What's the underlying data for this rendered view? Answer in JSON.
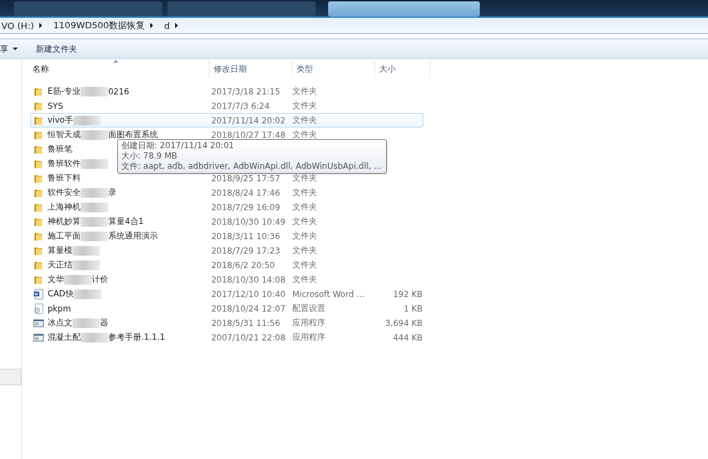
{
  "address_bar": {
    "crumbs": [
      "VO (H:)",
      "1109WD500数据恢复",
      "d"
    ]
  },
  "toolbar": {
    "buttons": [
      {
        "label": "享",
        "dropdown": true
      },
      {
        "label": "新建文件夹",
        "dropdown": false
      }
    ]
  },
  "table": {
    "columns": [
      {
        "label": "名称",
        "sorted": true
      },
      {
        "label": "修改日期",
        "sorted": false
      },
      {
        "label": "类型",
        "sorted": false
      },
      {
        "label": "大小",
        "sorted": false
      }
    ],
    "rows": [
      {
        "kind": "folder",
        "name": [
          "E筋-专业",
          "0216"
        ],
        "date": "2017/3/18 21:15",
        "type": "文件夹",
        "selected": false
      },
      {
        "kind": "folder",
        "name": [
          "SYS"
        ],
        "date": "2017/7/3 6:24",
        "type": "文件夹",
        "selected": false
      },
      {
        "kind": "folder",
        "name": [
          "vivo手"
        ],
        "redacted_tail": true,
        "date": "2017/11/14 20:02",
        "type": "文件夹",
        "selected": true
      },
      {
        "kind": "folder",
        "name": [
          "恒智天成",
          "面图布置系统"
        ],
        "date": "2018/10/27 17:48",
        "type": "文件夹",
        "selected": false
      },
      {
        "kind": "folder",
        "name": [
          "鲁班笔"
        ],
        "selected": false
      },
      {
        "kind": "folder",
        "name": [
          "鲁班软件"
        ],
        "redacted_tail": true,
        "selected": false
      },
      {
        "kind": "folder",
        "name": [
          "鲁班下料"
        ],
        "date": "2018/9/25 17:57",
        "type": "文件夹",
        "selected": false
      },
      {
        "kind": "folder",
        "name": [
          "软件安全",
          "录"
        ],
        "date": "2018/8/24 17:46",
        "type": "文件夹",
        "selected": false
      },
      {
        "kind": "folder",
        "name": [
          "上海神机"
        ],
        "redacted_tail": true,
        "date": "2018/7/29 16:09",
        "type": "文件夹",
        "selected": false
      },
      {
        "kind": "folder",
        "name": [
          "神机妙算",
          "算量4合1"
        ],
        "date": "2018/10/30 10:49",
        "type": "文件夹",
        "selected": false
      },
      {
        "kind": "folder",
        "name": [
          "施工平面",
          "系统通用演示"
        ],
        "date": "2018/3/11 10:36",
        "type": "文件夹",
        "selected": false
      },
      {
        "kind": "folder",
        "name": [
          "算量模"
        ],
        "redacted_tail": true,
        "date": "2018/7/29 17:23",
        "type": "文件夹",
        "selected": false
      },
      {
        "kind": "folder",
        "name": [
          "天正结"
        ],
        "redacted_tail": true,
        "date": "2018/6/2 20:50",
        "type": "文件夹",
        "selected": false
      },
      {
        "kind": "folder",
        "name": [
          "文华",
          "计价"
        ],
        "date": "2018/10/30 14:08",
        "type": "文件夹",
        "selected": false
      },
      {
        "kind": "word",
        "name": [
          "CAD快"
        ],
        "redacted_tail": true,
        "date": "2017/12/10 10:40",
        "type": "Microsoft Word ...",
        "size": "192 KB",
        "selected": false
      },
      {
        "kind": "config",
        "name": [
          "pkpm"
        ],
        "date": "2018/10/24 12:07",
        "type": "配置设置",
        "size": "1 KB",
        "selected": false
      },
      {
        "kind": "app",
        "name": [
          "冰点文",
          "器"
        ],
        "date": "2018/5/31 11:56",
        "type": "应用程序",
        "size": "3,694 KB",
        "selected": false
      },
      {
        "kind": "app",
        "name": [
          "混凝土配",
          "参考手册.1.1.1"
        ],
        "date": "2007/10/21 22:08",
        "type": "应用程序",
        "size": "444 KB",
        "selected": false
      }
    ]
  },
  "tooltip": {
    "lines": [
      "创建日期: 2017/11/14 20:01",
      "大小: 78.9 MB",
      "文件: aapt, adb, adbdriver, AdbWinApi.dll, AdbWinUsbApi.dll, ..."
    ]
  }
}
